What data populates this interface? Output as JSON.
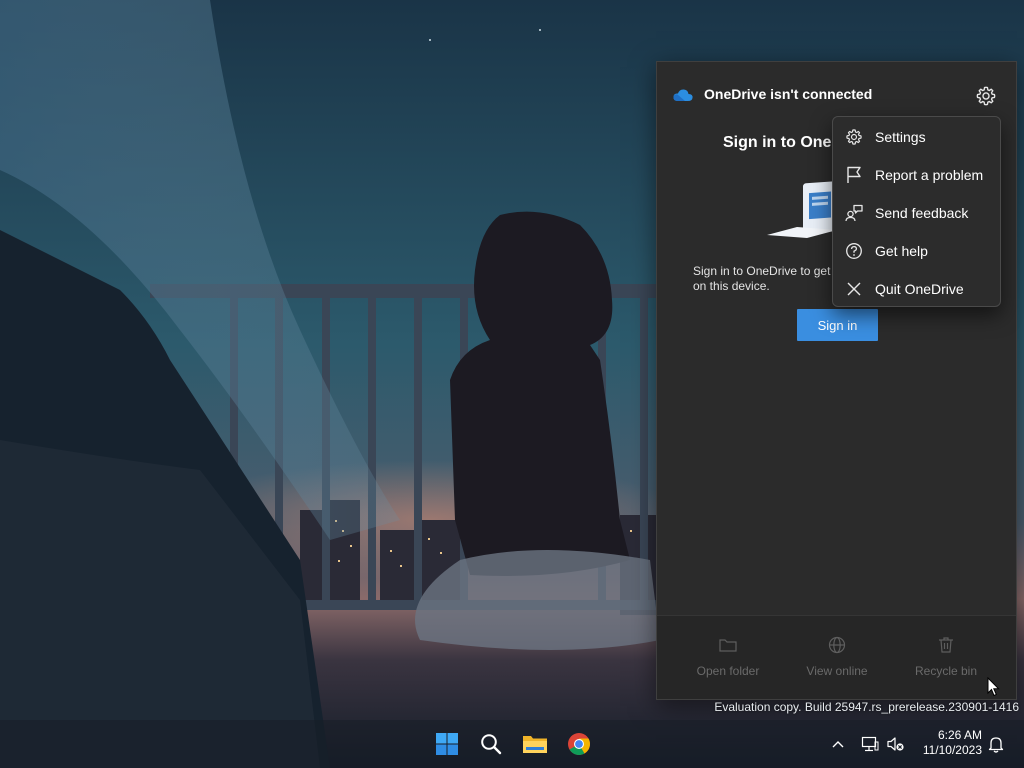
{
  "onedrive": {
    "title": "OneDrive isn't connected",
    "signin_heading": "Sign in to OneD",
    "signin_description": "Sign in to OneDrive to get on this device.",
    "signin_button": "Sign in",
    "footer": [
      {
        "label": "Open folder",
        "icon": "folder-icon"
      },
      {
        "label": "View online",
        "icon": "globe-icon"
      },
      {
        "label": "Recycle bin",
        "icon": "recycle-bin-icon"
      }
    ]
  },
  "menu": {
    "items": [
      {
        "label": "Settings",
        "icon": "gear-icon"
      },
      {
        "label": "Report a problem",
        "icon": "flag-icon"
      },
      {
        "label": "Send feedback",
        "icon": "feedback-icon"
      },
      {
        "label": "Get help",
        "icon": "help-icon"
      },
      {
        "label": "Quit OneDrive",
        "icon": "close-icon"
      }
    ]
  },
  "watermark": "Evaluation copy. Build 25947.rs_prerelease.230901-1416",
  "taskbar": {
    "apps": [
      "windows-start-icon",
      "search-icon",
      "file-explorer-icon",
      "chrome-icon"
    ],
    "time": "6:26 AM",
    "date": "11/10/2023"
  },
  "colors": {
    "accent": "#3a8ee0",
    "flyout_bg": "#2b2b2b",
    "menu_bg": "#2c2c2c",
    "footer_label": "#6a6a6a"
  }
}
